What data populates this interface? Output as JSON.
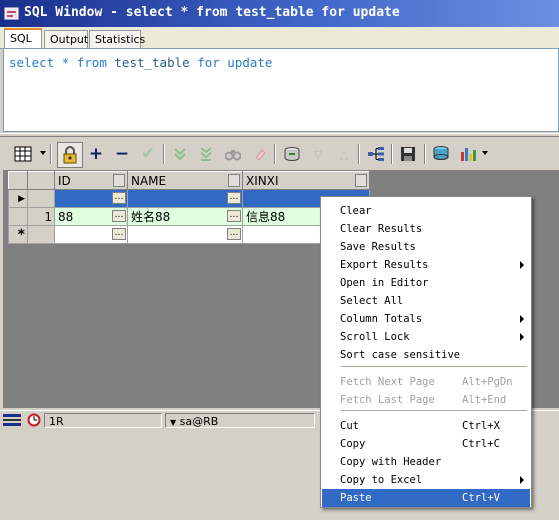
{
  "window": {
    "title": "SQL Window - select * from test_table for update"
  },
  "tabs": [
    {
      "label": "SQL",
      "active": true
    },
    {
      "label": "Output",
      "active": false
    },
    {
      "label": "Statistics",
      "active": false
    }
  ],
  "editor": {
    "kw_select": "select",
    "star": "*",
    "kw_from": "from",
    "table": "test_table",
    "kw_for": "for",
    "kw_update": "update"
  },
  "toolbar": {
    "icons": [
      "grid-options-icon",
      "lock-icon",
      "add-record-icon",
      "delete-record-icon",
      "post-changes-icon",
      "fetch-next-icon",
      "fetch-last-icon",
      "find-icon",
      "clear-icon",
      "export-icon",
      "sort-desc-icon",
      "sort-asc-icon",
      "tree-icon",
      "save-icon",
      "database-icon",
      "chart-icon"
    ]
  },
  "grid": {
    "columns": [
      "ID",
      "NAME",
      "XINXI"
    ],
    "rows": [
      {
        "rownum": "1",
        "id": "88",
        "name": "姓名88",
        "xinxi": "信息88"
      }
    ],
    "current_indicator": "▶",
    "new_indicator": "*"
  },
  "status": {
    "rowinfo": "1R",
    "connection": "sa@RB"
  },
  "context_menu": {
    "items": [
      {
        "label": "Clear",
        "shortcut": "",
        "disabled": false,
        "submenu": false,
        "highlight": false
      },
      {
        "label": "Clear Results",
        "shortcut": "",
        "disabled": false,
        "submenu": false,
        "highlight": false
      },
      {
        "label": "Save Results",
        "shortcut": "",
        "disabled": false,
        "submenu": false,
        "highlight": false
      },
      {
        "label": "Export Results",
        "shortcut": "",
        "disabled": false,
        "submenu": true,
        "highlight": false
      },
      {
        "label": "Open in Editor",
        "shortcut": "",
        "disabled": false,
        "submenu": false,
        "highlight": false
      },
      {
        "label": "Select All",
        "shortcut": "",
        "disabled": false,
        "submenu": false,
        "highlight": false
      },
      {
        "label": "Column Totals",
        "shortcut": "",
        "disabled": false,
        "submenu": true,
        "highlight": false
      },
      {
        "label": "Scroll Lock",
        "shortcut": "",
        "disabled": false,
        "submenu": true,
        "highlight": false
      },
      {
        "label": "Sort case sensitive",
        "shortcut": "",
        "disabled": false,
        "submenu": false,
        "highlight": false
      },
      {
        "label": "Fetch Next Page",
        "shortcut": "Alt+PgDn",
        "disabled": true,
        "submenu": false,
        "highlight": false
      },
      {
        "label": "Fetch Last Page",
        "shortcut": "Alt+End",
        "disabled": true,
        "submenu": false,
        "highlight": false
      },
      {
        "label": "Cut",
        "shortcut": "Ctrl+X",
        "disabled": false,
        "submenu": false,
        "highlight": false
      },
      {
        "label": "Copy",
        "shortcut": "Ctrl+C",
        "disabled": false,
        "submenu": false,
        "highlight": false
      },
      {
        "label": "Copy with Header",
        "shortcut": "",
        "disabled": false,
        "submenu": false,
        "highlight": false
      },
      {
        "label": "Copy to Excel",
        "shortcut": "",
        "disabled": false,
        "submenu": true,
        "highlight": false
      },
      {
        "label": "Paste",
        "shortcut": "Ctrl+V",
        "disabled": false,
        "submenu": false,
        "highlight": true
      }
    ]
  },
  "colors": {
    "title_bar": "#1a2f8c",
    "selection": "#316ac5",
    "editor_keyword": "#2a7cc7",
    "row_changed": "#dfffdf"
  }
}
